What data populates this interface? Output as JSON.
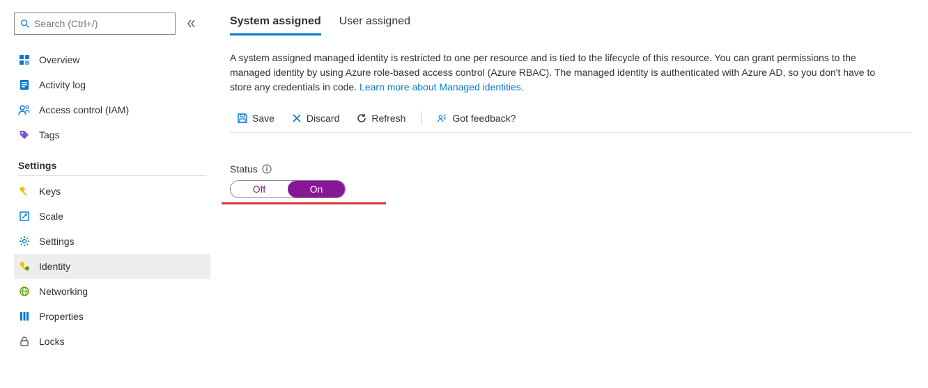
{
  "search": {
    "placeholder": "Search (Ctrl+/)"
  },
  "sidebar": {
    "items_top": [
      {
        "label": "Overview"
      },
      {
        "label": "Activity log"
      },
      {
        "label": "Access control (IAM)"
      },
      {
        "label": "Tags"
      }
    ],
    "section_title": "Settings",
    "items_settings": [
      {
        "label": "Keys"
      },
      {
        "label": "Scale"
      },
      {
        "label": "Settings"
      },
      {
        "label": "Identity"
      },
      {
        "label": "Networking"
      },
      {
        "label": "Properties"
      },
      {
        "label": "Locks"
      }
    ]
  },
  "tabs": [
    {
      "label": "System assigned"
    },
    {
      "label": "User assigned"
    }
  ],
  "description": {
    "text": "A system assigned managed identity is restricted to one per resource and is tied to the lifecycle of this resource. You can grant permissions to the managed identity by using Azure role-based access control (Azure RBAC). The managed identity is authenticated with Azure AD, so you don't have to store any credentials in code. ",
    "link": "Learn more about Managed identities."
  },
  "toolbar": {
    "save": "Save",
    "discard": "Discard",
    "refresh": "Refresh",
    "feedback": "Got feedback?"
  },
  "status": {
    "label": "Status",
    "off": "Off",
    "on": "On"
  }
}
